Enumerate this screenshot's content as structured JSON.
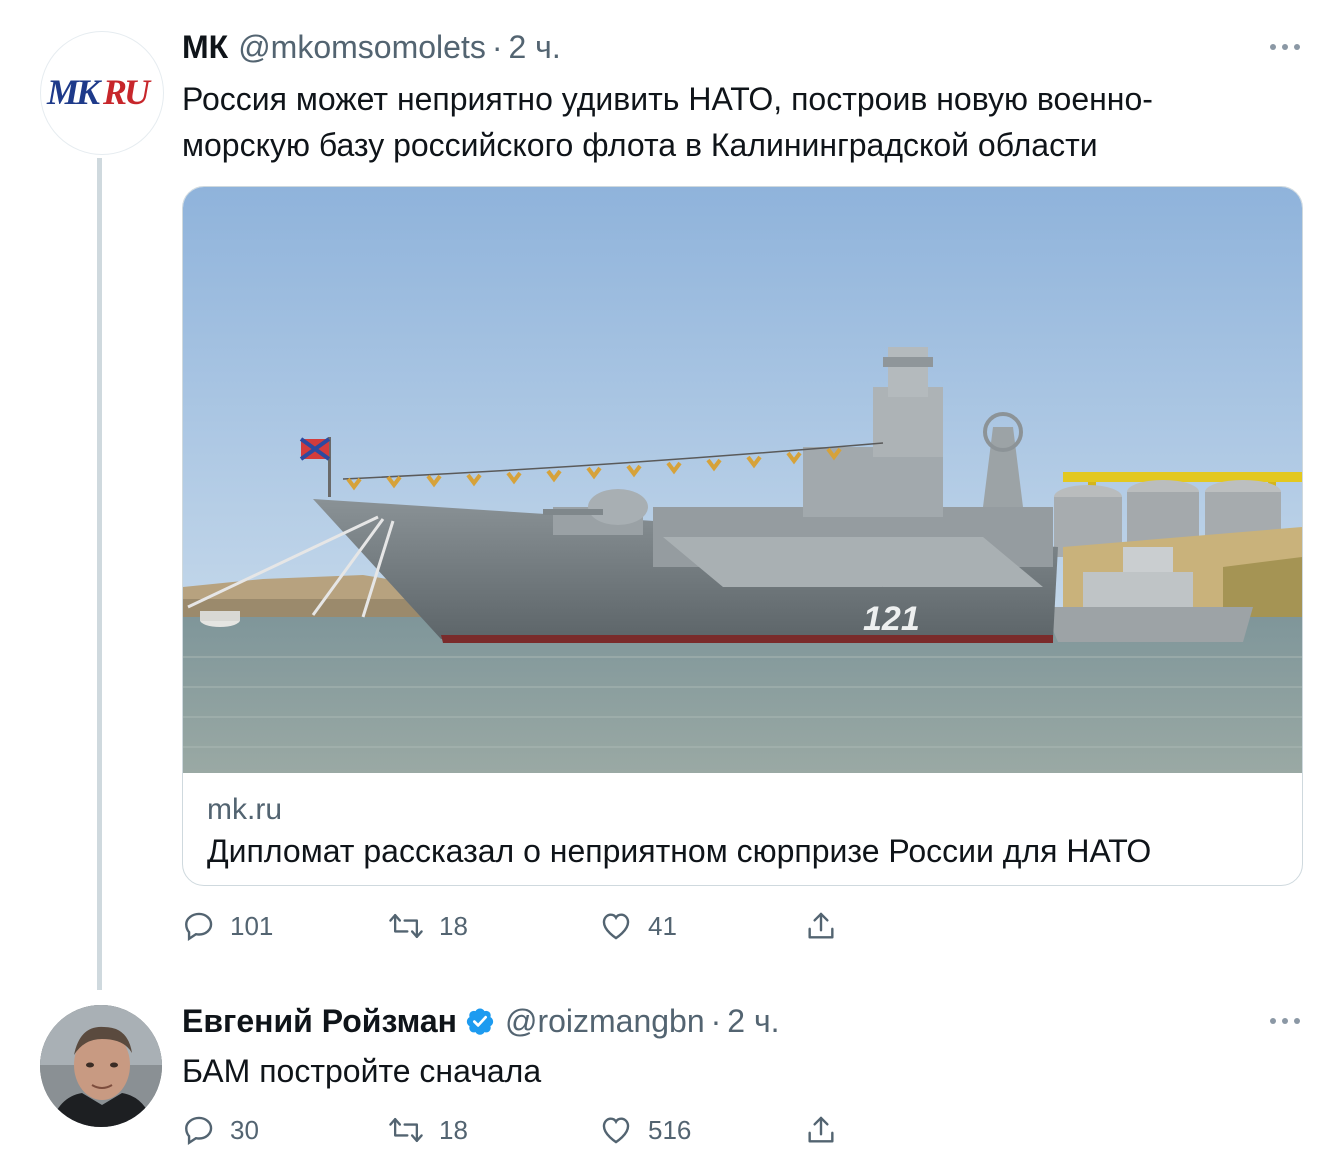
{
  "tweets": [
    {
      "name": "МК",
      "handle": "@mkomsomolets",
      "separator": "·",
      "time": "2 ч.",
      "avatar_logo": "MKRU",
      "text": "Россия может неприятно удивить НАТО, построив новую военно-морскую базу российского флота в Калининградской области",
      "card": {
        "image": "warship-121-photo",
        "hull_number": "121",
        "domain": "mk.ru",
        "title": "Дипломат рассказал о неприятном сюрпризе России для НАТО"
      },
      "actions": {
        "reply_icon": "reply-icon",
        "replies": "101",
        "retweet_icon": "retweet-icon",
        "retweets": "18",
        "like_icon": "heart-icon",
        "likes": "41",
        "share_icon": "share-icon"
      }
    },
    {
      "name": "Евгений Ройзман",
      "verified": true,
      "handle": "@roizmangbn",
      "separator": "·",
      "time": "2 ч.",
      "text": "БАМ постройте сначала",
      "actions": {
        "reply_icon": "reply-icon",
        "replies": "30",
        "retweet_icon": "retweet-icon",
        "retweets": "18",
        "like_icon": "heart-icon",
        "likes": "516",
        "share_icon": "share-icon"
      }
    }
  ],
  "colors": {
    "text": "#0f1419",
    "secondary": "#536471",
    "border": "#cfd9de",
    "verified": "#1d9bf0"
  }
}
